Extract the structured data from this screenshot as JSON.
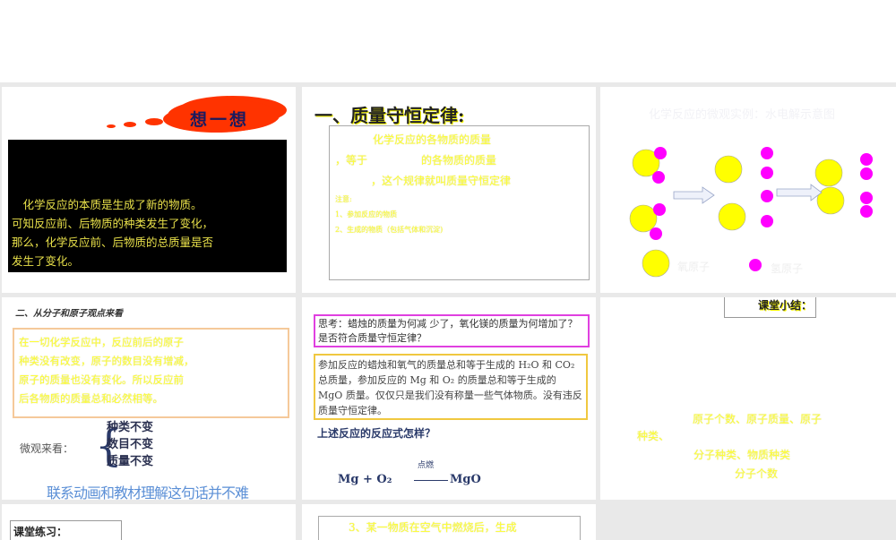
{
  "slides": [
    {
      "cloud": "想一想",
      "lines": [
        "　化学反应的本质是生成了新的物质。",
        "可知反应前、后物质的种类发生了变化，",
        "那么，化学反应前、后物质的总质量是否",
        "发生了变化。"
      ]
    },
    {
      "title": "一、质量守恒定律:",
      "lines": [
        "化学反应的各物质的质量",
        "，等于　　　　　的各物质的质量",
        "，这个规律就叫质量守恒定律"
      ],
      "notes": [
        "注意:",
        "1、参加反应的物质",
        "2、生成的物质（包括气体和沉淀)"
      ]
    },
    {
      "title": "化学反应的微观实例：水电解示意图",
      "legend_o": "氧原子",
      "legend_h": "氢原子",
      "colors": {
        "oxygen": "#ffff00",
        "hydrogen": "#ff00ff"
      }
    },
    {
      "heading": "二、从分子和原子观点来看",
      "box": [
        "在一切化学反应中，反应前后的原子",
        "种类没有改变，原子的数目没有增减，",
        "原子的质量也没有变化。所以反应前",
        "后各物质的质量总和必然相等。"
      ],
      "micro_label": "微观来看：",
      "micro_items": [
        "种类不变",
        "数目不变",
        "质量不变"
      ],
      "footer": "联系动画和教材理解这句话并不难"
    },
    {
      "think": "思考：蜡烛的质量为何减 少了，氧化镁的质量为何增加了？是否符合质量守恒定律？",
      "answer": "参加反应的蜡烛和氧气的质量总和等于生成的 H₂O 和 CO₂ 总质量，参加反应的 Mg 和 O₂ 的质量总和等于生成的 MgO 质量。仅仅只是我们没有称量一些气体物质。没有违反质量守恒定律。",
      "question": "上述反应的反应式怎样？",
      "condition": "点燃",
      "equation_left": "Mg + O₂",
      "equation_right": "MgO"
    },
    {
      "title": "课堂小结：",
      "lines": [
        "原子个数、原子质量、原子",
        "种类、",
        "分子种类、物质种类",
        "分子个数"
      ]
    },
    {
      "title": "课堂练习："
    },
    {
      "line": "3、某一物质在空气中燃烧后，生成"
    }
  ]
}
